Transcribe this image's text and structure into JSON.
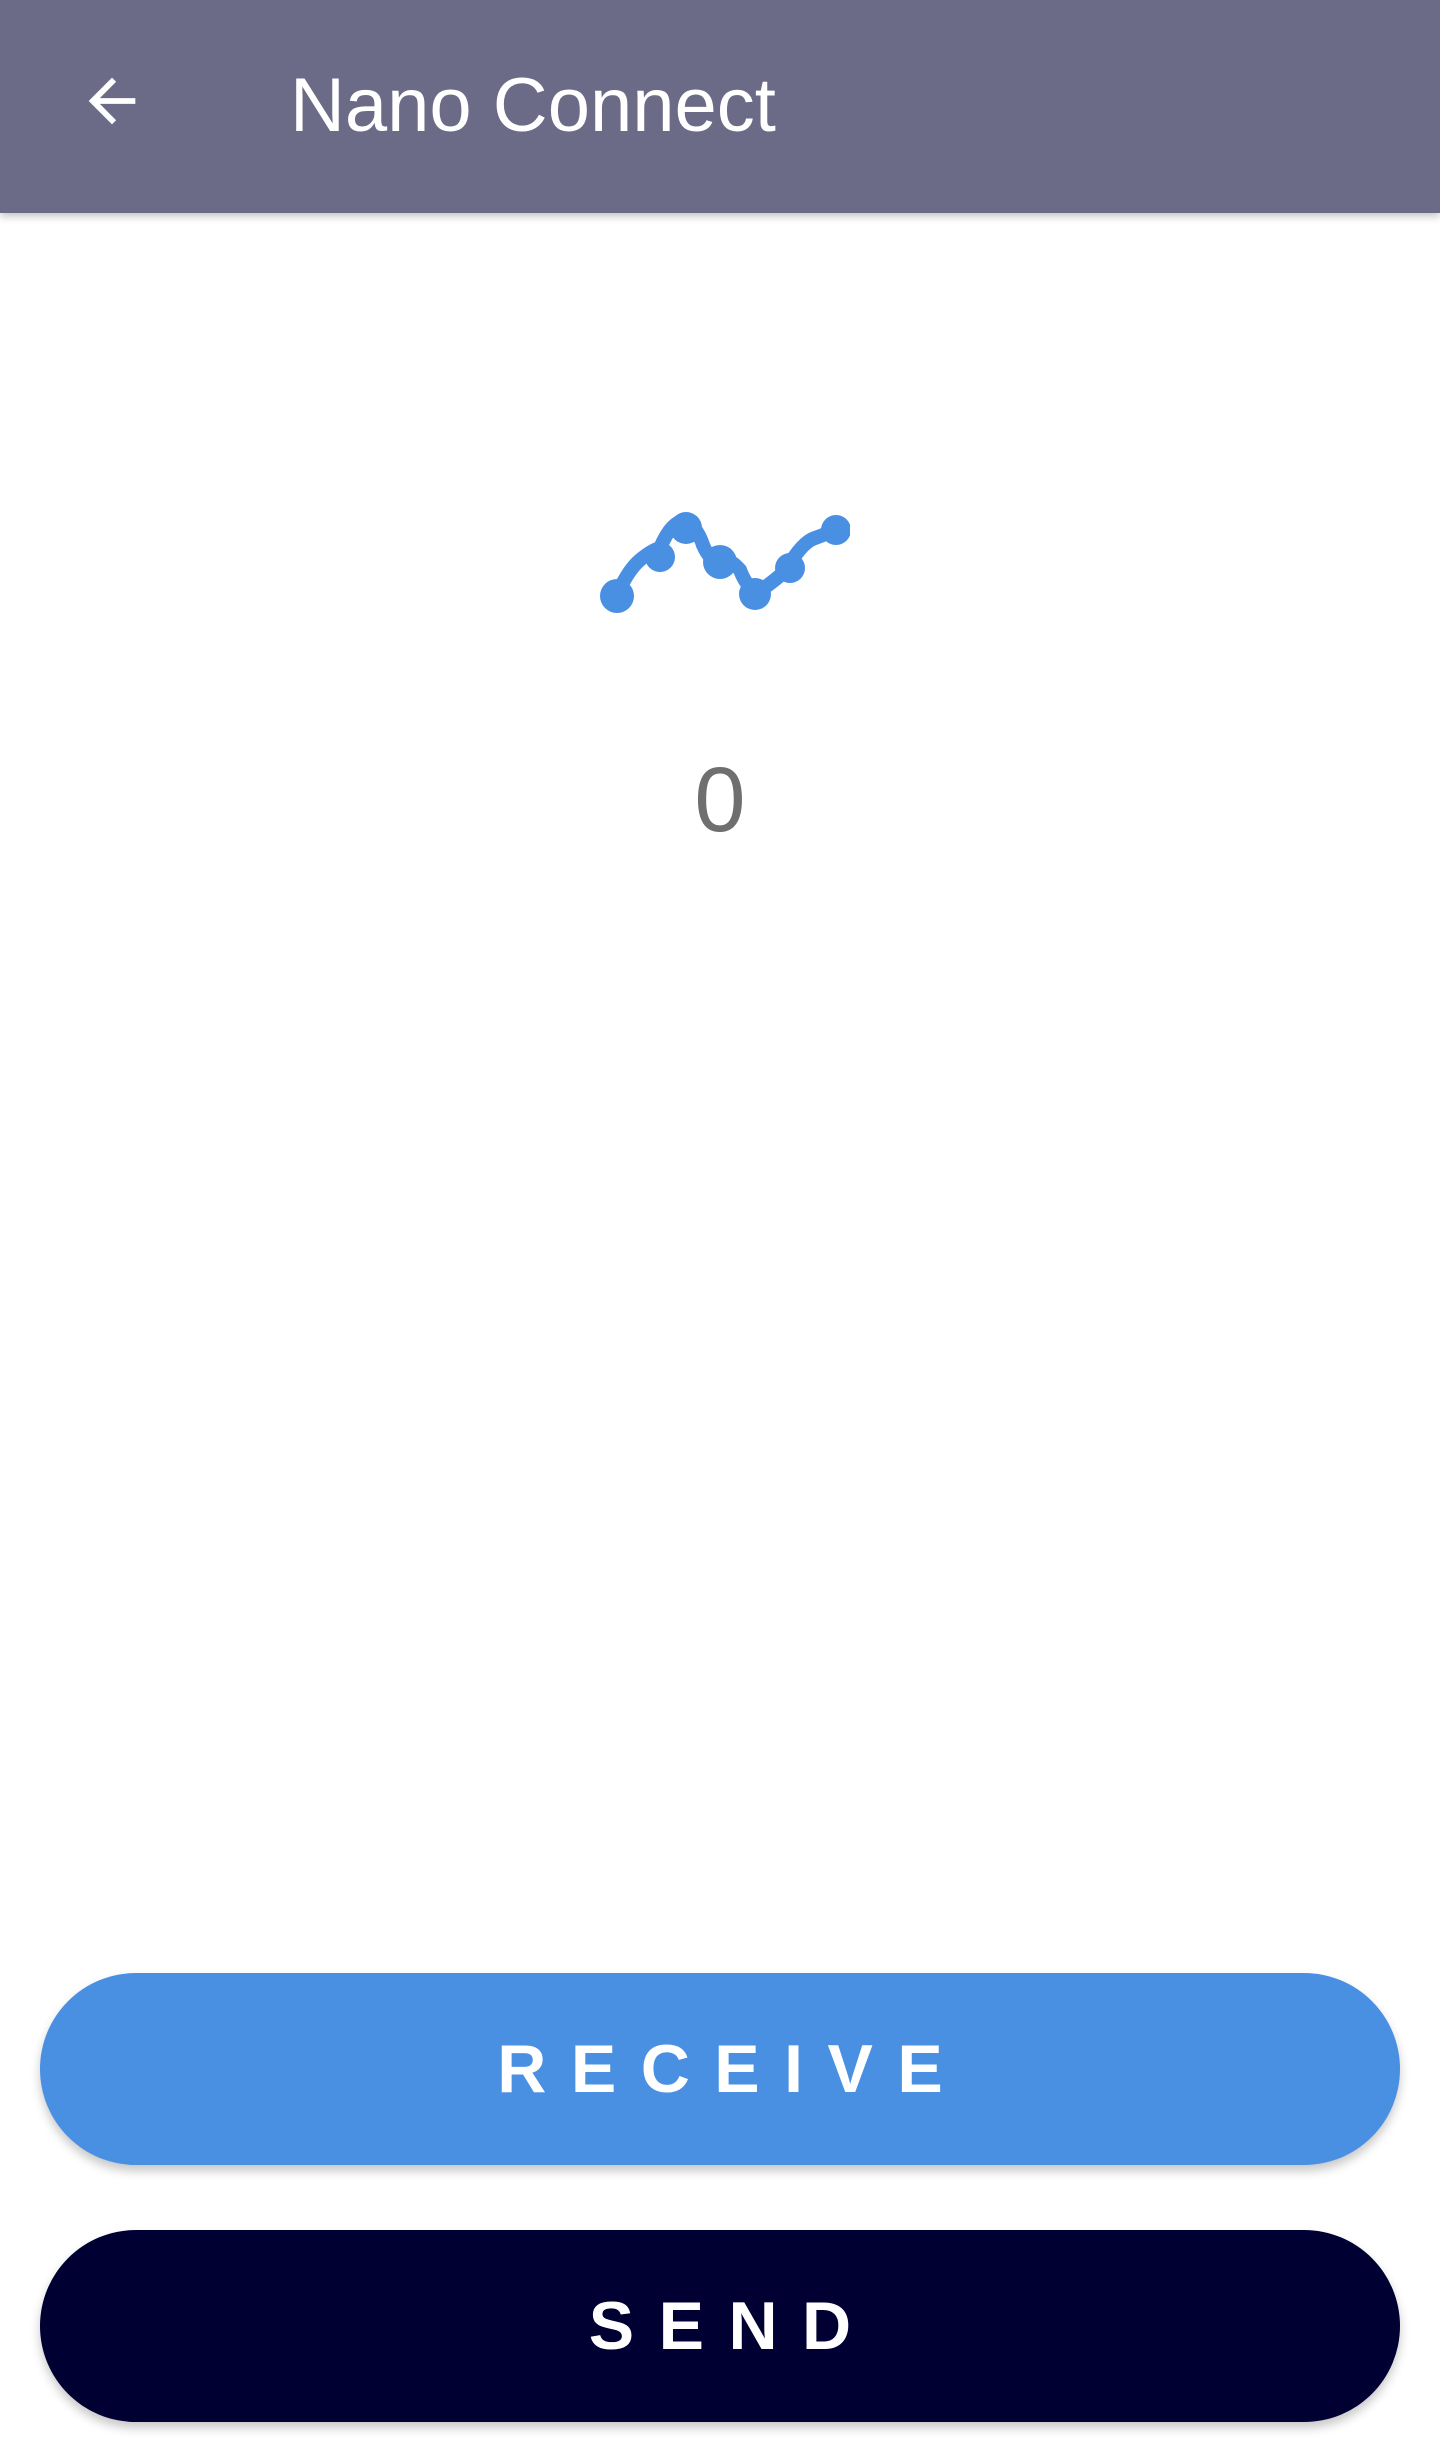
{
  "header": {
    "title": "Nano Connect",
    "back_icon": "arrow-left-icon"
  },
  "logo": {
    "icon": "nano-logo-icon",
    "color": "#4a90e2"
  },
  "balance": {
    "value": "0"
  },
  "actions": {
    "receive_label": "RECEIVE",
    "send_label": "SEND"
  },
  "colors": {
    "app_bar": "#6b6a87",
    "receive_button": "#4a90e2",
    "send_button": "#000033",
    "balance_text": "#6f6f6f"
  }
}
